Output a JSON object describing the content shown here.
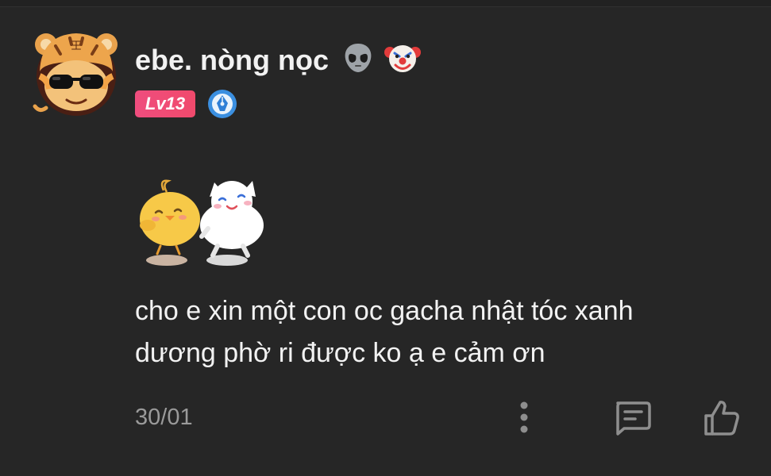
{
  "post": {
    "username": "ebe. nòng nọc",
    "username_emojis": [
      "alien-emoji",
      "clown-emoji"
    ],
    "level_badge": "Lv13",
    "verified_icon": "pen-nib-badge-icon",
    "message_lines": [
      "cho e xin một con oc gacha nhật tóc xanh",
      "dương phờ ri được ko ạ e cảm ơn"
    ],
    "date": "30/01"
  },
  "actions": {
    "more_icon": "more-vertical-icon",
    "comment_icon": "comment-icon",
    "like_icon": "thumbs-up-icon"
  },
  "colors": {
    "background": "#262626",
    "text": "#f2f2f2",
    "muted": "#9a9a9a",
    "level_badge": "#ef4d7e",
    "verified_badge": "#3b8fe0"
  }
}
